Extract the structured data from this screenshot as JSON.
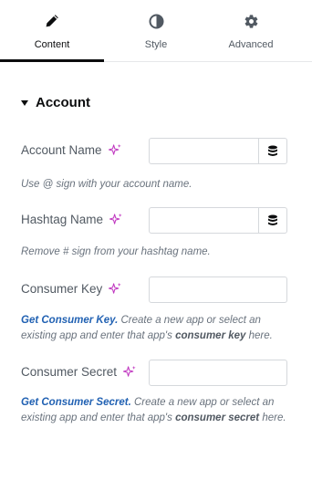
{
  "tabs": [
    {
      "label": "Content",
      "icon": "pencil-icon",
      "active": true
    },
    {
      "label": "Style",
      "icon": "half-circle-icon",
      "active": false
    },
    {
      "label": "Advanced",
      "icon": "gear-icon",
      "active": false
    }
  ],
  "section": {
    "title": "Account"
  },
  "fields": {
    "account_name": {
      "label": "Account Name",
      "value": "",
      "description": "Use @ sign with your account name."
    },
    "hashtag_name": {
      "label": "Hashtag Name",
      "value": "",
      "description": "Remove # sign from your hashtag name."
    },
    "consumer_key": {
      "label": "Consumer Key",
      "value": "",
      "desc_link": "Get Consumer Key.",
      "desc_pre": " Create a new app or select an existing app and enter that app's ",
      "desc_bold": "consumer key",
      "desc_post": " here."
    },
    "consumer_secret": {
      "label": "Consumer Secret",
      "value": "",
      "desc_link": "Get Consumer Secret.",
      "desc_pre": " Create a new app or select an existing app and enter that app's ",
      "desc_bold": "consumer secret",
      "desc_post": " here."
    }
  },
  "colors": {
    "sparkle": "#c036c0",
    "link": "#2262b3",
    "active_tab": "#0c0d0e"
  }
}
